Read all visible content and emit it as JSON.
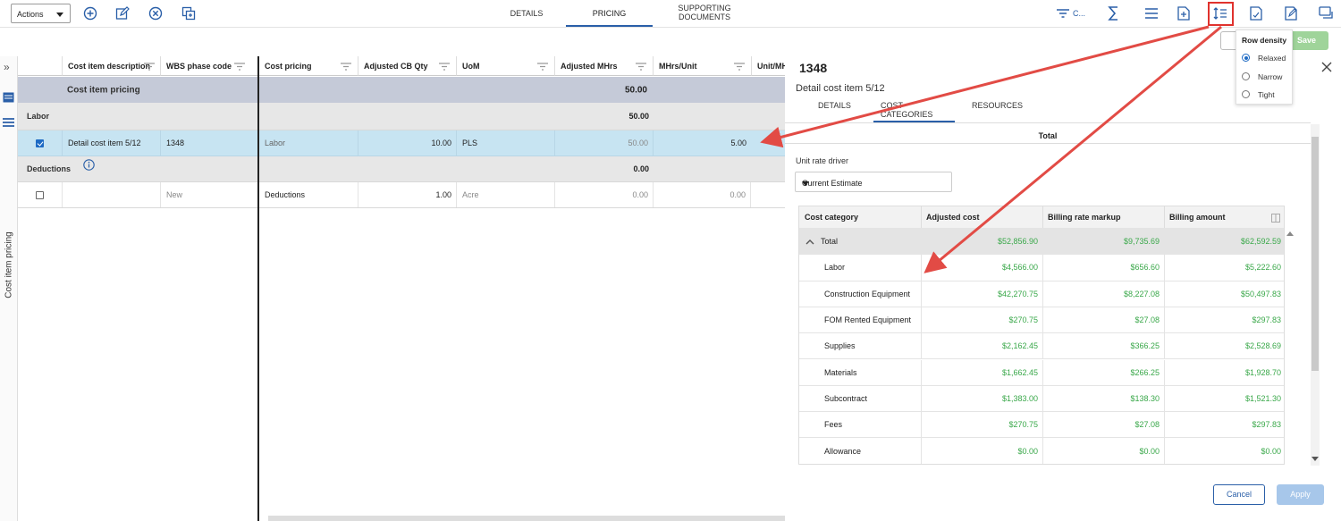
{
  "toolbar": {
    "actions_label": "Actions",
    "tabs": [
      {
        "label": "DETAILS",
        "active": false
      },
      {
        "label": "PRICING",
        "active": true
      },
      {
        "label": "SUPPORTING",
        "label2": "DOCUMENTS",
        "active": false
      }
    ],
    "columns_label": "C..."
  },
  "row_density": {
    "title": "Row density",
    "options": [
      {
        "label": "Relaxed",
        "selected": true
      },
      {
        "label": "Narrow",
        "selected": false
      },
      {
        "label": "Tight",
        "selected": false
      }
    ],
    "save_label": "Save"
  },
  "left_panel": {
    "vertical_label": "Cost item pricing"
  },
  "grid": {
    "left_headers": [
      "Cost item description",
      "WBS phase code"
    ],
    "right_headers": [
      "Cost pricing",
      "Adjusted CB Qty",
      "UoM",
      "Adjusted MHrs",
      "MHrs/Unit",
      "Unit/MH"
    ],
    "group_label": "Cost item pricing",
    "group_total": "50.00",
    "labor": {
      "label": "Labor",
      "total": "50.00"
    },
    "detail_row": {
      "description": "Detail cost item 5/12",
      "wbs": "1348",
      "cost_pricing": "Labor",
      "adjusted_cb_qty": "10.00",
      "uom": "PLS",
      "adjusted_mhrs": "50.00",
      "mhrs_unit": "5.00"
    },
    "deductions": {
      "label": "Deductions",
      "total": "0.00"
    },
    "deduction_row": {
      "wbs": "New",
      "cost_pricing": "Deductions",
      "adjusted_cb_qty": "1.00",
      "uom": "Acre",
      "adjusted_mhrs": "0.00",
      "mhrs_unit": "0.00"
    }
  },
  "panel": {
    "title": "1348",
    "subtitle": "Detail cost item 5/12",
    "tabs": [
      {
        "label": "DETAILS",
        "active": false
      },
      {
        "label": "COST CATEGORIES",
        "active": true
      },
      {
        "label": "RESOURCES",
        "active": false
      }
    ],
    "total_header": "Total",
    "unit_rate_driver_label": "Unit rate driver",
    "unit_rate_driver_value": "Current Estimate",
    "table_headers": [
      "Cost category",
      "Adjusted cost",
      "Billing rate markup",
      "Billing amount"
    ],
    "rows": [
      {
        "category": "Total",
        "adjusted": "$52,856.90",
        "markup": "$9,735.69",
        "billing": "$62,592.59",
        "is_total": true
      },
      {
        "category": "Labor",
        "adjusted": "$4,566.00",
        "markup": "$656.60",
        "billing": "$5,222.60"
      },
      {
        "category": "Construction Equipment",
        "adjusted": "$42,270.75",
        "markup": "$8,227.08",
        "billing": "$50,497.83"
      },
      {
        "category": "FOM Rented Equipment",
        "adjusted": "$270.75",
        "markup": "$27.08",
        "billing": "$297.83"
      },
      {
        "category": "Supplies",
        "adjusted": "$2,162.45",
        "markup": "$366.25",
        "billing": "$2,528.69"
      },
      {
        "category": "Materials",
        "adjusted": "$1,662.45",
        "markup": "$266.25",
        "billing": "$1,928.70"
      },
      {
        "category": "Subcontract",
        "adjusted": "$1,383.00",
        "markup": "$138.30",
        "billing": "$1,521.30"
      },
      {
        "category": "Fees",
        "adjusted": "$270.75",
        "markup": "$27.08",
        "billing": "$297.83"
      },
      {
        "category": "Allowance",
        "adjusted": "$0.00",
        "markup": "$0.00",
        "billing": "$0.00"
      }
    ],
    "cancel_label": "Cancel",
    "apply_label": "Apply"
  },
  "colors": {
    "accent": "#2a5fa8",
    "highlight": "#e0322d",
    "money": "#3aa84a",
    "selected_row": "#c7e4f2",
    "group_row": "#c5cad8"
  }
}
